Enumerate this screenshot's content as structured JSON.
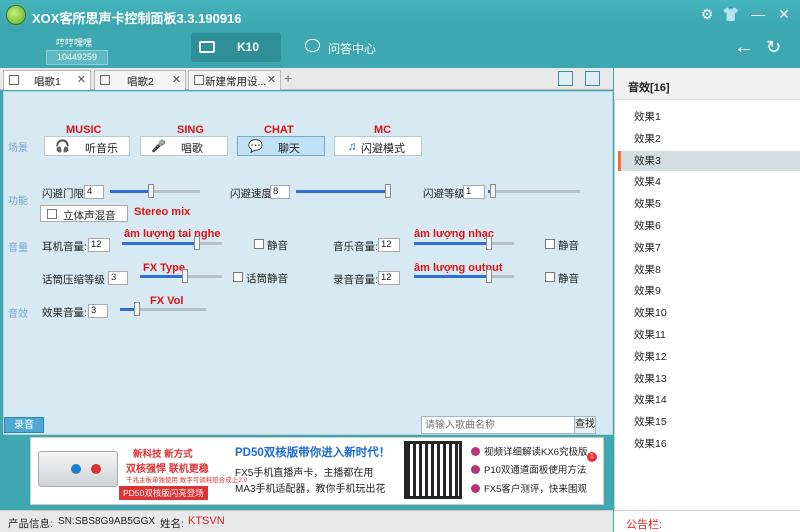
{
  "window": {
    "title": "XOX客所思声卡控制面板3.3.190916",
    "icons": [
      "gear-icon",
      "shirt-icon",
      "minimize-icon",
      "close-icon"
    ]
  },
  "header": {
    "user_label": "哼哼嘿嘿",
    "user_id": "10449259",
    "tabs": [
      {
        "label": "K10",
        "icon": "keyboard-icon"
      },
      {
        "label": "问答中心",
        "icon": "chat-icon"
      }
    ]
  },
  "doc_tabs": [
    {
      "label": "唱歌1"
    },
    {
      "label": "唱歌2"
    },
    {
      "label": "新建常用设..."
    }
  ],
  "sections": {
    "scene": "场景",
    "function": "功能",
    "volume": "音量",
    "effect": "音效"
  },
  "scenes": [
    {
      "label": "听音乐",
      "annotation": "MUSIC",
      "icon": "headphones-icon"
    },
    {
      "label": "唱歌",
      "annotation": "SING",
      "icon": "microphone-icon"
    },
    {
      "label": "聊天",
      "annotation": "CHAT",
      "icon": "chat-bubble-icon"
    },
    {
      "label": "闪避模式",
      "annotation": "MC",
      "icon": "music-note-icon"
    }
  ],
  "function_row": {
    "threshold": {
      "label": "闪避门限",
      "value": "4",
      "level": 0.45
    },
    "speed": {
      "label": "闪避速度",
      "value": "8",
      "level": 1.0
    },
    "level": {
      "label": "闪避等级",
      "value": "1",
      "level": 0.05
    },
    "stereo_mix": {
      "label": "立体声混音",
      "annotation": "Stereo mix"
    }
  },
  "volume": {
    "earphone": {
      "label": "耳机音量:",
      "value": "12",
      "annotation": "âm lượng tai nghe",
      "level": 0.75,
      "mute": "静音"
    },
    "music": {
      "label": "音乐音量:",
      "value": "12",
      "annotation": "âm lượng nhạc",
      "level": 0.75,
      "mute": "静音"
    },
    "mic_compress": {
      "label": "话筒压缩等级",
      "value": "3",
      "annotation": "FX Type",
      "level": 0.55,
      "mute": "话筒静音"
    },
    "record": {
      "label": "录音音量:",
      "value": "12",
      "annotation": "âm lượng output",
      "level": 0.75,
      "mute": "静音"
    }
  },
  "effect": {
    "label": "效果音量:",
    "value": "3",
    "annotation": "FX Vol",
    "level": 0.2
  },
  "bottom": {
    "record_button": "录音",
    "search_placeholder": "请输入歌曲名称",
    "search_button": "查找"
  },
  "ad": {
    "promo1": "新科技 新方式",
    "promo2": "双核强悍 联机更稳",
    "promo3": "千兆主板单独使用 数字可调耗赔合成上2.0",
    "promo4": "PD50双核版闪亮登场",
    "headline": "PD50双核版带你进入新时代！",
    "text1": "FX5手机直播声卡，主播都在用",
    "text2": "MA3手机适配器，教你手机玩出花",
    "links": [
      "视频详细解读KX6究极版",
      "P10双通道面板使用方法",
      "FX5客户测评，快来围观"
    ],
    "badge": "1"
  },
  "status": {
    "product_label": "产品信息:",
    "sn_label": "SN:",
    "sn": "SBS8G9AB5GGX",
    "name_label": "姓名:",
    "name": "KTSVN"
  },
  "sidebar": {
    "title": "音效[16]",
    "items": [
      "效果1",
      "效果2",
      "效果3",
      "效果4",
      "效果5",
      "效果6",
      "效果7",
      "效果8",
      "效果9",
      "效果10",
      "效果11",
      "效果12",
      "效果13",
      "效果14",
      "效果15",
      "效果16"
    ],
    "selected_index": 2,
    "notice_label": "公告栏:"
  }
}
